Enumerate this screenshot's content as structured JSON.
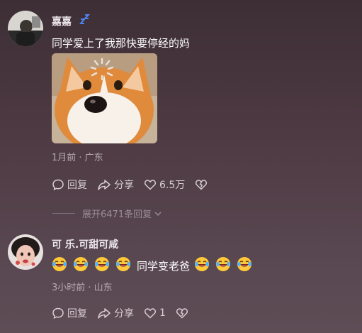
{
  "comments": [
    {
      "username": "嘉嘉",
      "status_icon": "sleep-zz-icon",
      "text": "同学爱上了我那快要停经的妈",
      "sticker": "corgi-dog-sticker",
      "meta": "1月前 · 广东",
      "reply_label": "回复",
      "share_label": "分享",
      "like_count": "6.5万"
    },
    {
      "username": "可 乐.可甜可咸",
      "text": "同学变老爸",
      "emoji_before": 4,
      "emoji_after": 3,
      "emoji_name": "laughing-crying-emoji",
      "meta": "3小时前 · 山东",
      "reply_label": "回复",
      "share_label": "分享",
      "like_count": "1"
    }
  ],
  "expand_replies_label": "展开6471条回复",
  "colors": {
    "background_top": "#3d2e35",
    "background_bottom": "#5f4d56",
    "meta_text": "#b7aab1",
    "username_text": "#ece6ea"
  }
}
